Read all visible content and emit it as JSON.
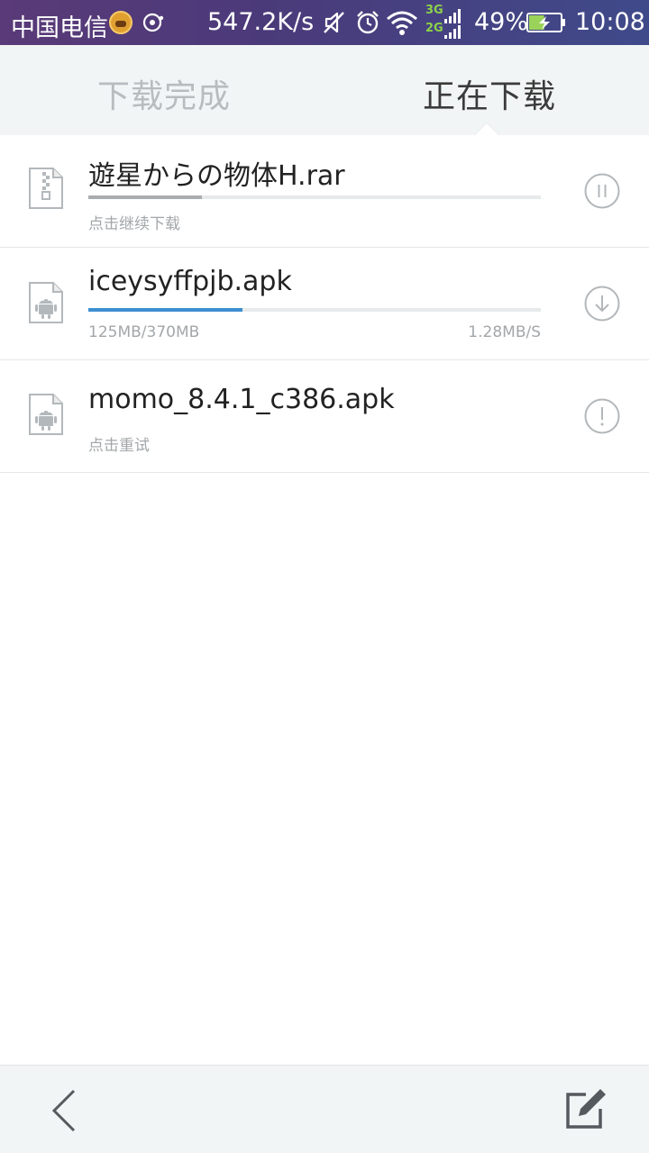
{
  "status_bar": {
    "carrier": "中国电信",
    "net_speed": "547.2K/s",
    "network_3g": "3G",
    "network_2g": "2G",
    "battery_percent": "49%",
    "battery_level": 0.49,
    "time": "10:08",
    "icons": [
      "avatar-icon",
      "disc-icon",
      "mute-icon",
      "alarm-icon",
      "wifi-icon",
      "signal-icon",
      "battery-charging-icon"
    ]
  },
  "tabs": [
    {
      "label": "下载完成",
      "active": false
    },
    {
      "label": "正在下载",
      "active": true
    }
  ],
  "downloads": [
    {
      "name": "遊星からの物体H.rar",
      "file_type": "archive",
      "progress": 0.25,
      "progress_color": "#a9adb0",
      "status": "点击继续下载",
      "speed": "",
      "action_icon": "pause-icon"
    },
    {
      "name": "iceysyffpjb.apk",
      "file_type": "apk",
      "progress": 0.34,
      "progress_color": "#3d8fd1",
      "status": "125MB/370MB",
      "speed": "1.28MB/S",
      "action_icon": "download-icon"
    },
    {
      "name": "momo_8.4.1_c386.apk",
      "file_type": "apk",
      "progress": null,
      "progress_color": "",
      "status": "点击重试",
      "speed": "",
      "action_icon": "error-icon"
    }
  ],
  "bottom_bar": {
    "back_icon": "back-arrow-icon",
    "edit_icon": "edit-icon"
  },
  "colors": {
    "accent_progress": "#3d8fd1",
    "paused_progress": "#a9adb0",
    "tab_active": "#3b3b3b",
    "tab_inactive": "#b8bcbf"
  }
}
